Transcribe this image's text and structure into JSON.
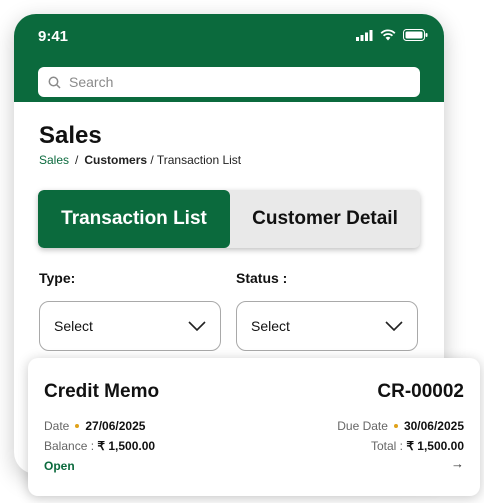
{
  "status_bar": {
    "time": "9:41"
  },
  "search": {
    "placeholder": "Search"
  },
  "page": {
    "title": "Sales"
  },
  "breadcrumb": {
    "item1": "Sales",
    "sep1": "/",
    "item2": "Customers",
    "sep2": "/",
    "item3": "Transaction List"
  },
  "tabs": {
    "active": "Transaction List",
    "inactive": "Customer Detail"
  },
  "filters": {
    "type": {
      "label": "Type:",
      "value": "Select"
    },
    "status": {
      "label": "Status :",
      "value": "Select"
    }
  },
  "card": {
    "title": "Credit Memo",
    "number": "CR-00002",
    "date_label": "Date",
    "date_value": "27/06/2025",
    "due_label": "Due Date",
    "due_value": "30/06/2025",
    "balance_label": "Balance :",
    "balance_value": "₹ 1,500.00",
    "total_label": "Total :",
    "total_value": "₹ 1,500.00",
    "status": "Open",
    "arrow": "→"
  },
  "colors": {
    "primary": "#0b6a3d",
    "accent_dot": "#e0a21a"
  }
}
